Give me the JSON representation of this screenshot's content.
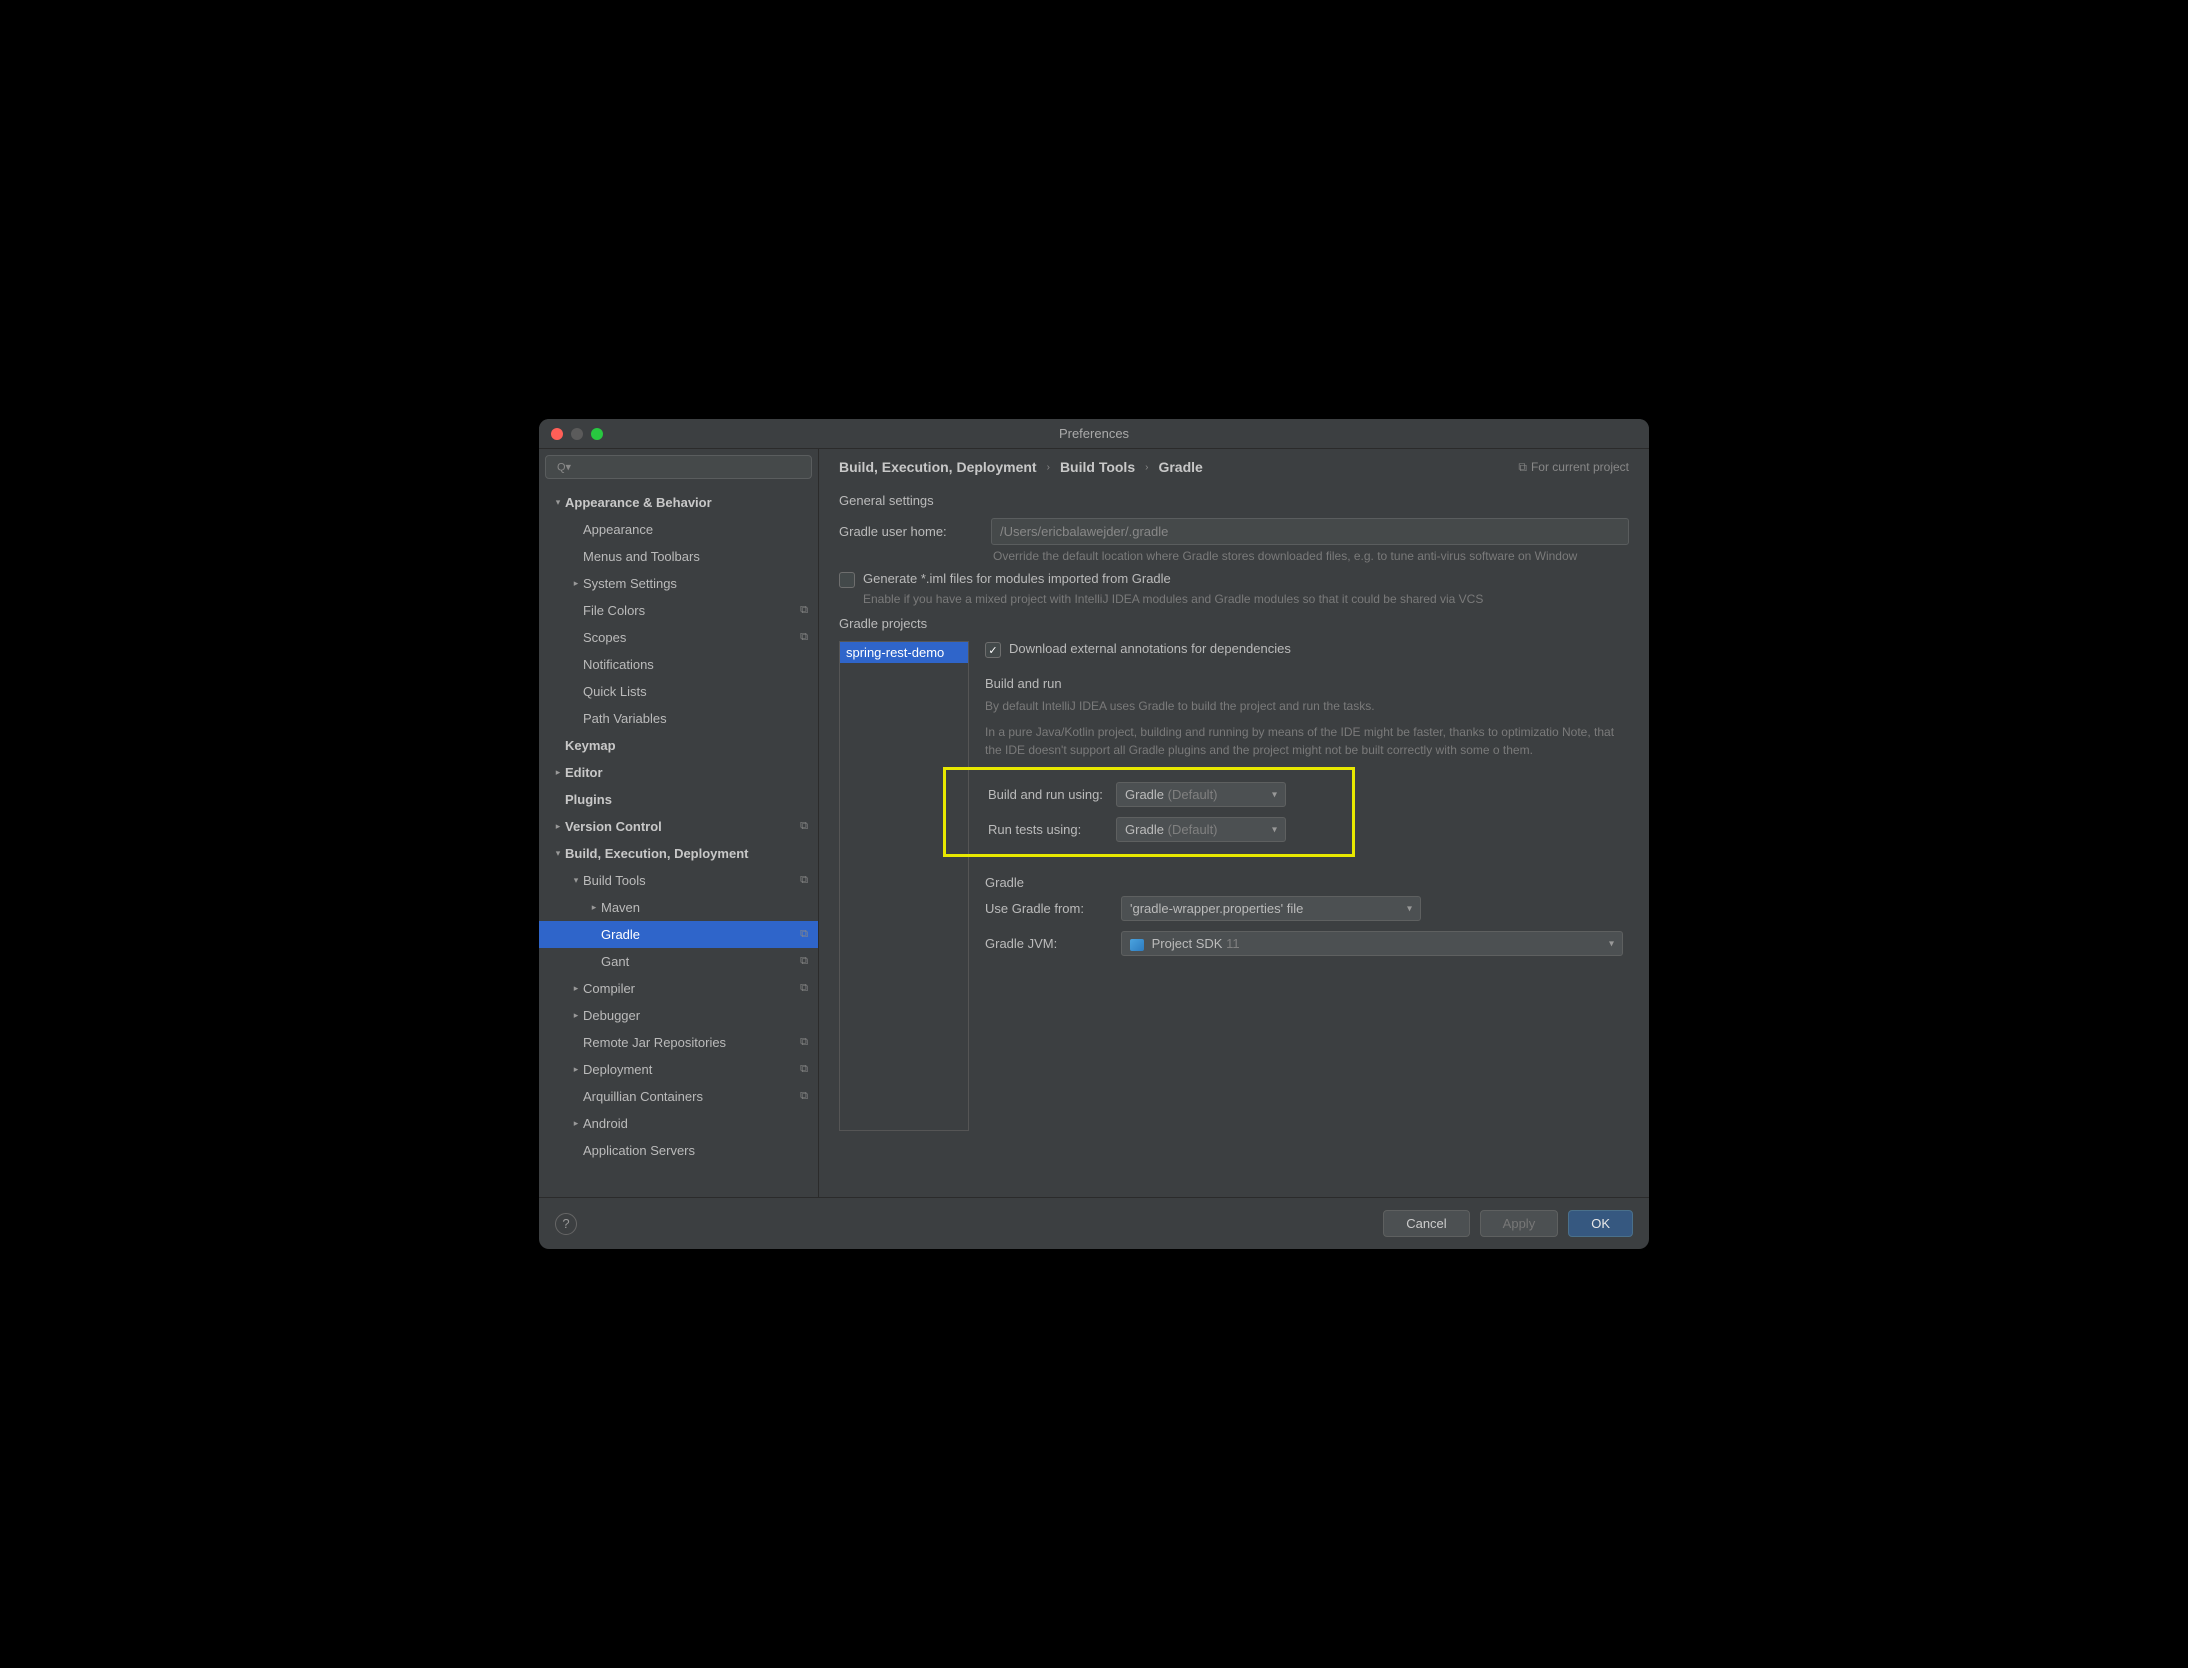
{
  "window": {
    "title": "Preferences"
  },
  "search": {
    "placeholder": ""
  },
  "sidebar": [
    {
      "label": "Appearance & Behavior",
      "indent": 0,
      "bold": true,
      "chev": "down"
    },
    {
      "label": "Appearance",
      "indent": 1
    },
    {
      "label": "Menus and Toolbars",
      "indent": 1
    },
    {
      "label": "System Settings",
      "indent": 1,
      "chev": "right"
    },
    {
      "label": "File Colors",
      "indent": 1,
      "badge": true,
      "chev": ""
    },
    {
      "label": "Scopes",
      "indent": 1,
      "badge": true,
      "chev": ""
    },
    {
      "label": "Notifications",
      "indent": 1
    },
    {
      "label": "Quick Lists",
      "indent": 1
    },
    {
      "label": "Path Variables",
      "indent": 1
    },
    {
      "label": "Keymap",
      "indent": 0,
      "bold": true
    },
    {
      "label": "Editor",
      "indent": 0,
      "bold": true,
      "chev": "right"
    },
    {
      "label": "Plugins",
      "indent": 0,
      "bold": true
    },
    {
      "label": "Version Control",
      "indent": 0,
      "bold": true,
      "chev": "right",
      "badge": true
    },
    {
      "label": "Build, Execution, Deployment",
      "indent": 0,
      "bold": true,
      "chev": "down"
    },
    {
      "label": "Build Tools",
      "indent": 1,
      "chev": "down",
      "badge": true
    },
    {
      "label": "Maven",
      "indent": 2,
      "chev": "right"
    },
    {
      "label": "Gradle",
      "indent": 2,
      "selected": true,
      "badge": true
    },
    {
      "label": "Gant",
      "indent": 2,
      "badge": true
    },
    {
      "label": "Compiler",
      "indent": 1,
      "chev": "right",
      "badge": true
    },
    {
      "label": "Debugger",
      "indent": 1,
      "chev": "right"
    },
    {
      "label": "Remote Jar Repositories",
      "indent": 1,
      "badge": true
    },
    {
      "label": "Deployment",
      "indent": 1,
      "chev": "right",
      "badge": true
    },
    {
      "label": "Arquillian Containers",
      "indent": 1,
      "badge": true
    },
    {
      "label": "Android",
      "indent": 1,
      "chev": "right"
    },
    {
      "label": "Application Servers",
      "indent": 1
    }
  ],
  "breadcrumb": [
    "Build, Execution, Deployment",
    "Build Tools",
    "Gradle"
  ],
  "scope": "For current project",
  "general": {
    "title": "General settings",
    "user_home_label": "Gradle user home:",
    "user_home_value": "/Users/ericbalawejder/.gradle",
    "user_home_hint": "Override the default location where Gradle stores downloaded files, e.g. to tune anti-virus software on Window",
    "generate_iml": "Generate *.iml files for modules imported from Gradle",
    "generate_iml_hint": "Enable if you have a mixed project with IntelliJ IDEA modules and Gradle modules so that it could be shared via VCS"
  },
  "projects": {
    "title": "Gradle projects",
    "selected": "spring-rest-demo",
    "download_annotations": "Download external annotations for dependencies",
    "build_run_title": "Build and run",
    "desc1": "By default IntelliJ IDEA uses Gradle to build the project and run the tasks.",
    "desc2": "In a pure Java/Kotlin project, building and running by means of the IDE might be faster, thanks to optimizatio Note, that the IDE doesn't support all Gradle plugins and the project might not be built correctly with some o them.",
    "build_using_label": "Build and run using:",
    "build_using_value": "Gradle",
    "build_using_default": "(Default)",
    "tests_using_label": "Run tests using:",
    "tests_using_value": "Gradle",
    "tests_using_default": "(Default)",
    "gradle_title": "Gradle",
    "use_from_label": "Use Gradle from:",
    "use_from_value": "'gradle-wrapper.properties' file",
    "jvm_label": "Gradle JVM:",
    "jvm_value": "Project SDK",
    "jvm_version": "11"
  },
  "footer": {
    "cancel": "Cancel",
    "apply": "Apply",
    "ok": "OK"
  }
}
